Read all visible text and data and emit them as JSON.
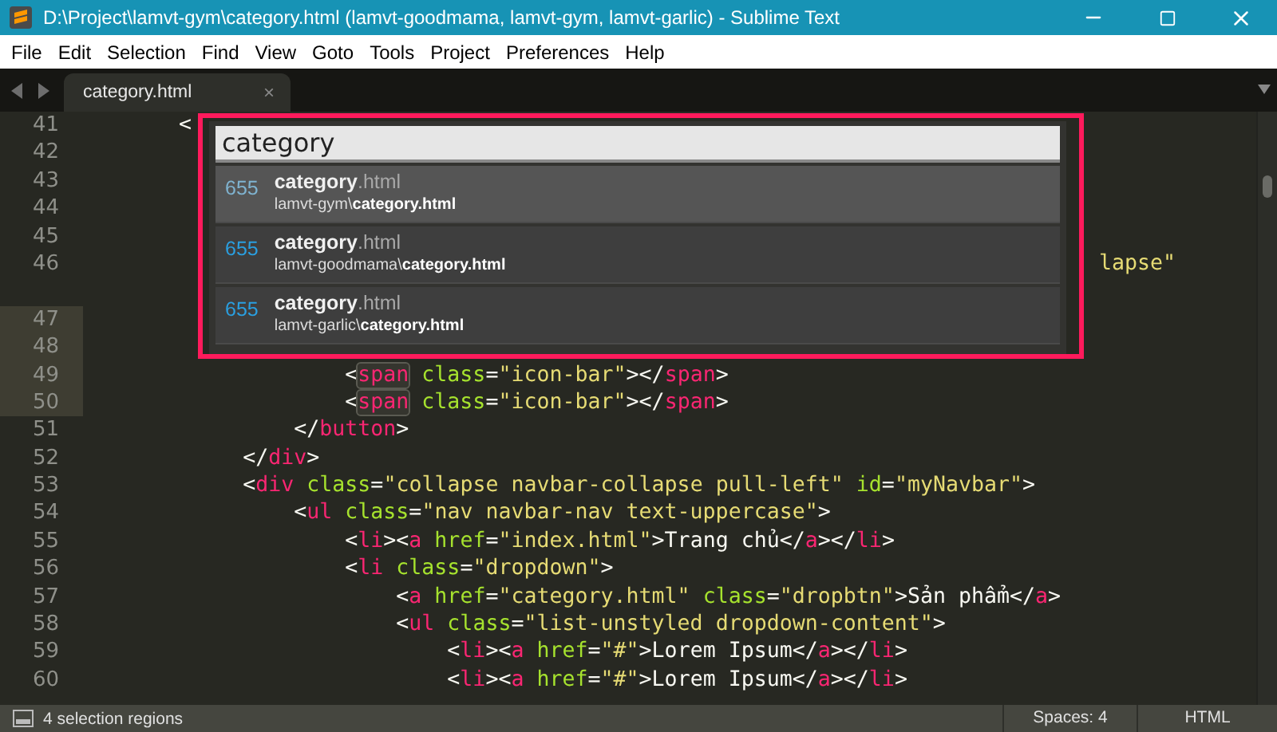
{
  "window": {
    "title": "D:\\Project\\lamvt-gym\\category.html (lamvt-goodmama, lamvt-gym, lamvt-garlic) - Sublime Text"
  },
  "menu": [
    "File",
    "Edit",
    "Selection",
    "Find",
    "View",
    "Goto",
    "Tools",
    "Project",
    "Preferences",
    "Help"
  ],
  "tabs": [
    {
      "label": "category.html",
      "selected": true,
      "close": "×"
    }
  ],
  "editor": {
    "rows": [
      {
        "kind": "line",
        "number": "41",
        "selected": false,
        "tokens": [
          {
            "kind": "punct",
            "text": "       <"
          }
        ]
      },
      {
        "kind": "line",
        "number": "42",
        "selected": false
      },
      {
        "kind": "line",
        "number": "43",
        "selected": false
      },
      {
        "kind": "line",
        "number": "44",
        "selected": false
      },
      {
        "kind": "line",
        "number": "45",
        "selected": false
      },
      {
        "kind": "line",
        "number": "46",
        "selected": false,
        "tokens": [
          {
            "kind": "string",
            "text": "                                                                               lapse\""
          }
        ]
      },
      {
        "kind": "wrap"
      },
      {
        "kind": "line",
        "number": "47",
        "selected": true
      },
      {
        "kind": "line",
        "number": "48",
        "selected": true
      },
      {
        "kind": "line",
        "number": "49",
        "selected": true,
        "tokens": [
          {
            "kind": "punct",
            "text": "                    <"
          },
          {
            "kind": "tag",
            "text": "span",
            "selected": true
          },
          {
            "kind": "attr",
            "text": " class"
          },
          {
            "kind": "punct",
            "text": "="
          },
          {
            "kind": "string",
            "text": "\"icon-bar\""
          },
          {
            "kind": "punct",
            "text": "></"
          },
          {
            "kind": "tag",
            "text": "span"
          },
          {
            "kind": "punct",
            "text": ">"
          }
        ]
      },
      {
        "kind": "line",
        "number": "50",
        "selected": true,
        "tokens": [
          {
            "kind": "punct",
            "text": "                    <"
          },
          {
            "kind": "tag",
            "text": "span",
            "selected": true
          },
          {
            "kind": "attr",
            "text": " class"
          },
          {
            "kind": "punct",
            "text": "="
          },
          {
            "kind": "string",
            "text": "\"icon-bar\""
          },
          {
            "kind": "punct",
            "text": "></"
          },
          {
            "kind": "tag",
            "text": "span"
          },
          {
            "kind": "punct",
            "text": ">"
          }
        ]
      },
      {
        "kind": "line",
        "number": "51",
        "selected": false,
        "tokens": [
          {
            "kind": "punct",
            "text": "                </"
          },
          {
            "kind": "tag",
            "text": "button"
          },
          {
            "kind": "punct",
            "text": ">"
          }
        ]
      },
      {
        "kind": "line",
        "number": "52",
        "selected": false,
        "tokens": [
          {
            "kind": "punct",
            "text": "            </"
          },
          {
            "kind": "tag",
            "text": "div"
          },
          {
            "kind": "punct",
            "text": ">"
          }
        ]
      },
      {
        "kind": "line",
        "number": "53",
        "selected": false,
        "tokens": [
          {
            "kind": "punct",
            "text": "            <"
          },
          {
            "kind": "tag",
            "text": "div"
          },
          {
            "kind": "attr",
            "text": " class"
          },
          {
            "kind": "punct",
            "text": "="
          },
          {
            "kind": "string",
            "text": "\"collapse navbar-collapse pull-left\""
          },
          {
            "kind": "attr",
            "text": " id"
          },
          {
            "kind": "punct",
            "text": "="
          },
          {
            "kind": "string",
            "text": "\"myNavbar\""
          },
          {
            "kind": "punct",
            "text": ">"
          }
        ]
      },
      {
        "kind": "line",
        "number": "54",
        "selected": false,
        "tokens": [
          {
            "kind": "punct",
            "text": "                <"
          },
          {
            "kind": "tag",
            "text": "ul"
          },
          {
            "kind": "attr",
            "text": " class"
          },
          {
            "kind": "punct",
            "text": "="
          },
          {
            "kind": "string",
            "text": "\"nav navbar-nav text-uppercase\""
          },
          {
            "kind": "punct",
            "text": ">"
          }
        ]
      },
      {
        "kind": "line",
        "number": "55",
        "selected": false,
        "tokens": [
          {
            "kind": "punct",
            "text": "                    <"
          },
          {
            "kind": "tag",
            "text": "li"
          },
          {
            "kind": "punct",
            "text": "><"
          },
          {
            "kind": "tag",
            "text": "a"
          },
          {
            "kind": "attr",
            "text": " href"
          },
          {
            "kind": "punct",
            "text": "="
          },
          {
            "kind": "string",
            "text": "\"index.html\""
          },
          {
            "kind": "punct",
            "text": ">Trang chủ</"
          },
          {
            "kind": "tag",
            "text": "a"
          },
          {
            "kind": "punct",
            "text": "></"
          },
          {
            "kind": "tag",
            "text": "li"
          },
          {
            "kind": "punct",
            "text": ">"
          }
        ]
      },
      {
        "kind": "line",
        "number": "56",
        "selected": false,
        "tokens": [
          {
            "kind": "punct",
            "text": "                    <"
          },
          {
            "kind": "tag",
            "text": "li"
          },
          {
            "kind": "attr",
            "text": " class"
          },
          {
            "kind": "punct",
            "text": "="
          },
          {
            "kind": "string",
            "text": "\"dropdown\""
          },
          {
            "kind": "punct",
            "text": ">"
          }
        ]
      },
      {
        "kind": "line",
        "number": "57",
        "selected": false,
        "tokens": [
          {
            "kind": "punct",
            "text": "                        <"
          },
          {
            "kind": "tag",
            "text": "a"
          },
          {
            "kind": "attr",
            "text": " href"
          },
          {
            "kind": "punct",
            "text": "="
          },
          {
            "kind": "string",
            "text": "\"category.html\""
          },
          {
            "kind": "attr",
            "text": " class"
          },
          {
            "kind": "punct",
            "text": "="
          },
          {
            "kind": "string",
            "text": "\"dropbtn\""
          },
          {
            "kind": "punct",
            "text": ">Sản phẩm</"
          },
          {
            "kind": "tag",
            "text": "a"
          },
          {
            "kind": "punct",
            "text": ">"
          }
        ]
      },
      {
        "kind": "line",
        "number": "58",
        "selected": false,
        "tokens": [
          {
            "kind": "punct",
            "text": "                        <"
          },
          {
            "kind": "tag",
            "text": "ul"
          },
          {
            "kind": "attr",
            "text": " class"
          },
          {
            "kind": "punct",
            "text": "="
          },
          {
            "kind": "string",
            "text": "\"list-unstyled dropdown-content\""
          },
          {
            "kind": "punct",
            "text": ">"
          }
        ]
      },
      {
        "kind": "line",
        "number": "59",
        "selected": false,
        "tokens": [
          {
            "kind": "punct",
            "text": "                            <"
          },
          {
            "kind": "tag",
            "text": "li"
          },
          {
            "kind": "punct",
            "text": "><"
          },
          {
            "kind": "tag",
            "text": "a"
          },
          {
            "kind": "attr",
            "text": " href"
          },
          {
            "kind": "punct",
            "text": "="
          },
          {
            "kind": "string",
            "text": "\"#\""
          },
          {
            "kind": "punct",
            "text": ">Lorem Ipsum</"
          },
          {
            "kind": "tag",
            "text": "a"
          },
          {
            "kind": "punct",
            "text": "></"
          },
          {
            "kind": "tag",
            "text": "li"
          },
          {
            "kind": "punct",
            "text": ">"
          }
        ]
      },
      {
        "kind": "line",
        "number": "60",
        "selected": false,
        "tokens": [
          {
            "kind": "punct",
            "text": "                            <"
          },
          {
            "kind": "tag",
            "text": "li"
          },
          {
            "kind": "punct",
            "text": "><"
          },
          {
            "kind": "tag",
            "text": "a"
          },
          {
            "kind": "attr",
            "text": " href"
          },
          {
            "kind": "punct",
            "text": "="
          },
          {
            "kind": "string",
            "text": "\"#\""
          },
          {
            "kind": "punct",
            "text": ">Lorem Ipsum</"
          },
          {
            "kind": "tag",
            "text": "a"
          },
          {
            "kind": "punct",
            "text": "></"
          },
          {
            "kind": "tag",
            "text": "li"
          },
          {
            "kind": "punct",
            "text": ">"
          }
        ]
      }
    ]
  },
  "goto_panel": {
    "query": "category",
    "results": [
      {
        "score": "655",
        "title": "**category**.html",
        "path": "lamvt-gym\\**category.html**",
        "selected": true
      },
      {
        "score": "655",
        "title": "**category**.html",
        "path": "lamvt-goodmama\\**category.html**",
        "selected": false
      },
      {
        "score": "655",
        "title": "**category**.html",
        "path": "lamvt-garlic\\**category.html**",
        "selected": false
      }
    ]
  },
  "status_bar": {
    "message": "4 selection regions",
    "indentation": "Spaces: 4",
    "syntax": "HTML"
  }
}
